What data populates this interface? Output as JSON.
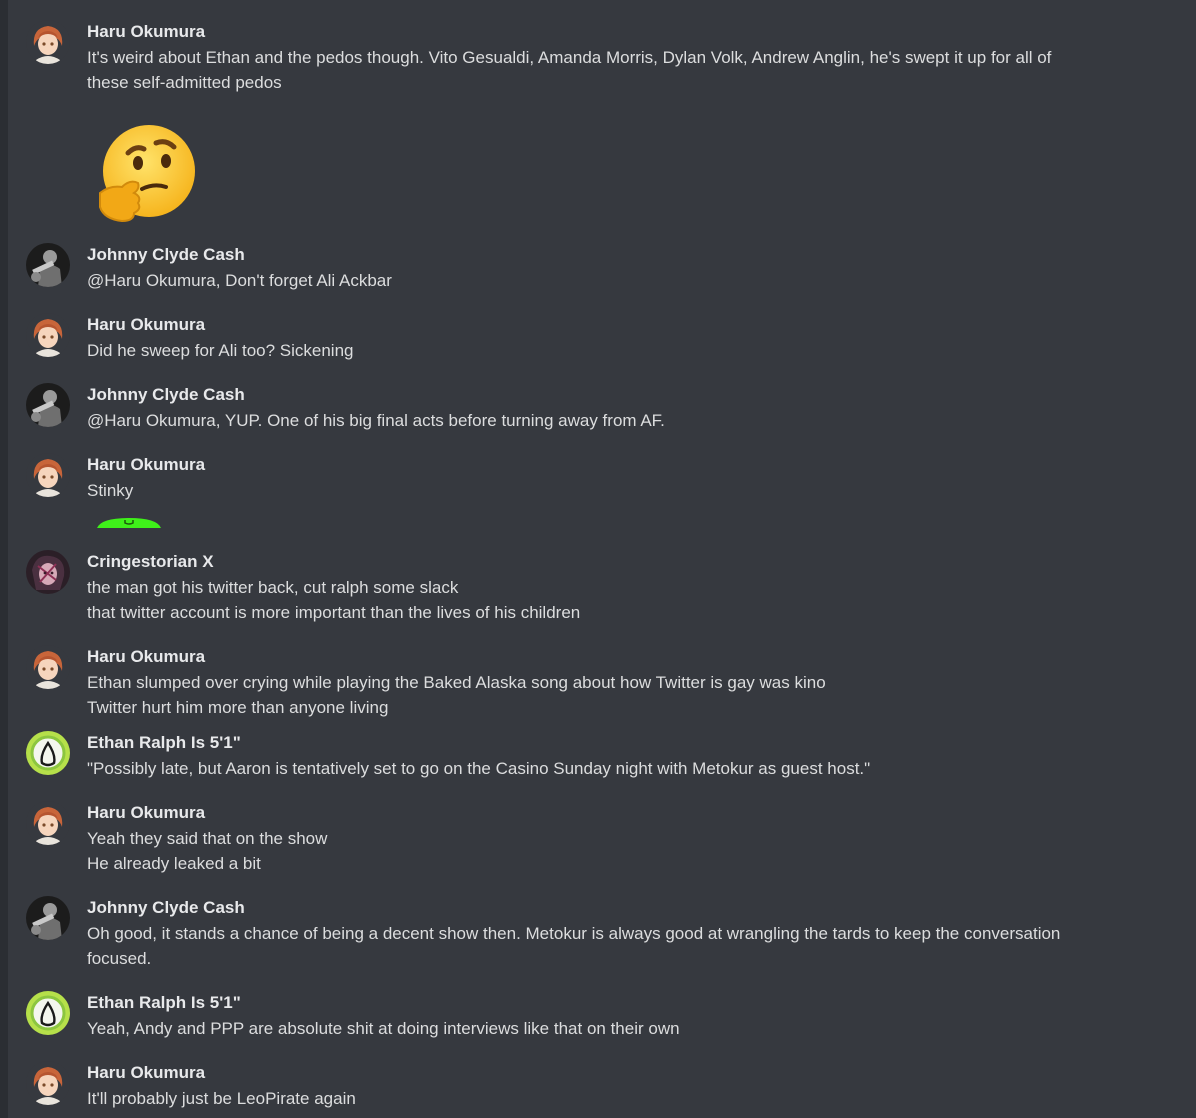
{
  "colors": {
    "background": "#36393f",
    "name": "#e8e9eb",
    "text": "#dcddde"
  },
  "messages": [
    {
      "author": "Haru Okumura",
      "avatar": "haru-avatar",
      "lines": [
        "It's weird about Ethan and the pedos though. Vito Gesualdi, Amanda Morris, Dylan Volk, Andrew Anglin, he's swept it up for all of",
        "these self-admitted pedos"
      ],
      "attachment": "thinking-face-emoji"
    },
    {
      "author": "Johnny Clyde Cash",
      "avatar": "johnny-avatar",
      "lines": [
        "@Haru Okumura, Don't forget Ali Ackbar"
      ]
    },
    {
      "author": "Haru Okumura",
      "avatar": "haru-avatar",
      "lines": [
        "Did he sweep for Ali too? Sickening"
      ]
    },
    {
      "author": "Johnny Clyde Cash",
      "avatar": "johnny-avatar",
      "lines": [
        "@Haru Okumura, YUP. One of his big final acts before turning away from AF."
      ]
    },
    {
      "author": "Haru Okumura",
      "avatar": "haru-avatar",
      "lines": [
        "Stinky"
      ],
      "attachment": "green-sticker"
    },
    {
      "author": "Cringestorian X",
      "avatar": "cringestorian-avatar",
      "lines": [
        "the man got his twitter back, cut ralph some slack",
        "that twitter account is more important than the lives of his children"
      ]
    },
    {
      "author": "Haru Okumura",
      "avatar": "haru-avatar",
      "lines": [
        "Ethan slumped over crying while playing the Baked Alaska song about how Twitter is gay was kino",
        "Twitter hurt him more than anyone living"
      ]
    },
    {
      "author": "Ethan Ralph Is 5'1\"",
      "avatar": "ethan-avatar",
      "lines": [
        "\"Possibly late, but Aaron is tentatively set to go on the Casino Sunday night with Metokur as guest host.\""
      ]
    },
    {
      "author": "Haru Okumura",
      "avatar": "haru-avatar",
      "lines": [
        "Yeah they said that on the show",
        "He already leaked a bit"
      ]
    },
    {
      "author": "Johnny Clyde Cash",
      "avatar": "johnny-avatar",
      "lines": [
        "Oh good, it stands a chance of being a decent show then. Metokur is always good at wrangling the tards to keep the conversation",
        "focused."
      ]
    },
    {
      "author": "Ethan Ralph Is 5'1\"",
      "avatar": "ethan-avatar",
      "lines": [
        "Yeah, Andy and PPP are absolute shit at doing interviews like that on their own"
      ]
    },
    {
      "author": "Haru Okumura",
      "avatar": "haru-avatar",
      "lines": [
        "It'll probably just be LeoPirate again"
      ]
    }
  ]
}
